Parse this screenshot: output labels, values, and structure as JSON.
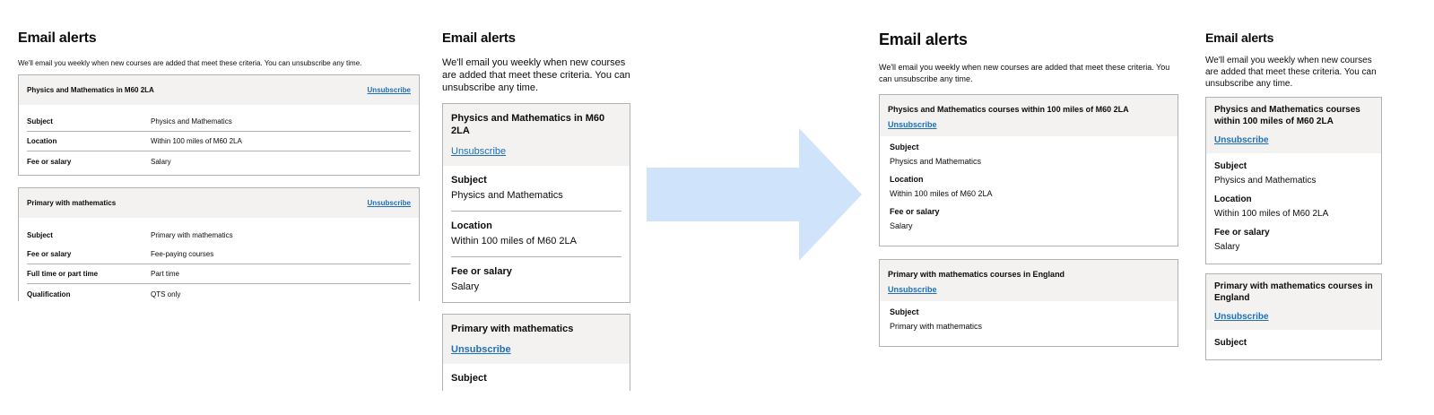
{
  "heading": "Email alerts",
  "intro": "We'll email you weekly when new courses are added that meet these criteria. You can unsubscribe any time.",
  "unsubscribe_label": "Unsubscribe",
  "labels": {
    "subject": "Subject",
    "location": "Location",
    "fee": "Fee or salary",
    "study_mode": "Full time or part time",
    "qualification": "Qualification"
  },
  "before": {
    "alert1": {
      "title": "Physics and Mathematics in M60 2LA",
      "subject": "Physics and Mathematics",
      "location": "Within 100 miles of M60 2LA",
      "fee": "Salary"
    },
    "alert2": {
      "title": "Primary with mathematics",
      "subject": "Primary with mathematics",
      "fee": "Fee-paying courses",
      "study_mode": "Part time",
      "qualification": "QTS only"
    }
  },
  "after": {
    "alert1": {
      "title": "Physics and Mathematics courses within 100 miles of M60 2LA",
      "subject": "Physics and Mathematics",
      "location": "Within 100 miles of M60 2LA",
      "fee": "Salary"
    },
    "alert2": {
      "title": "Primary with mathematics courses in England",
      "subject": "Primary with mathematics"
    }
  },
  "colors": {
    "link": "#1d70b8",
    "header_bg": "#f3f2f1",
    "border": "#b1b4b6",
    "arrow": "#cfe3fb"
  }
}
